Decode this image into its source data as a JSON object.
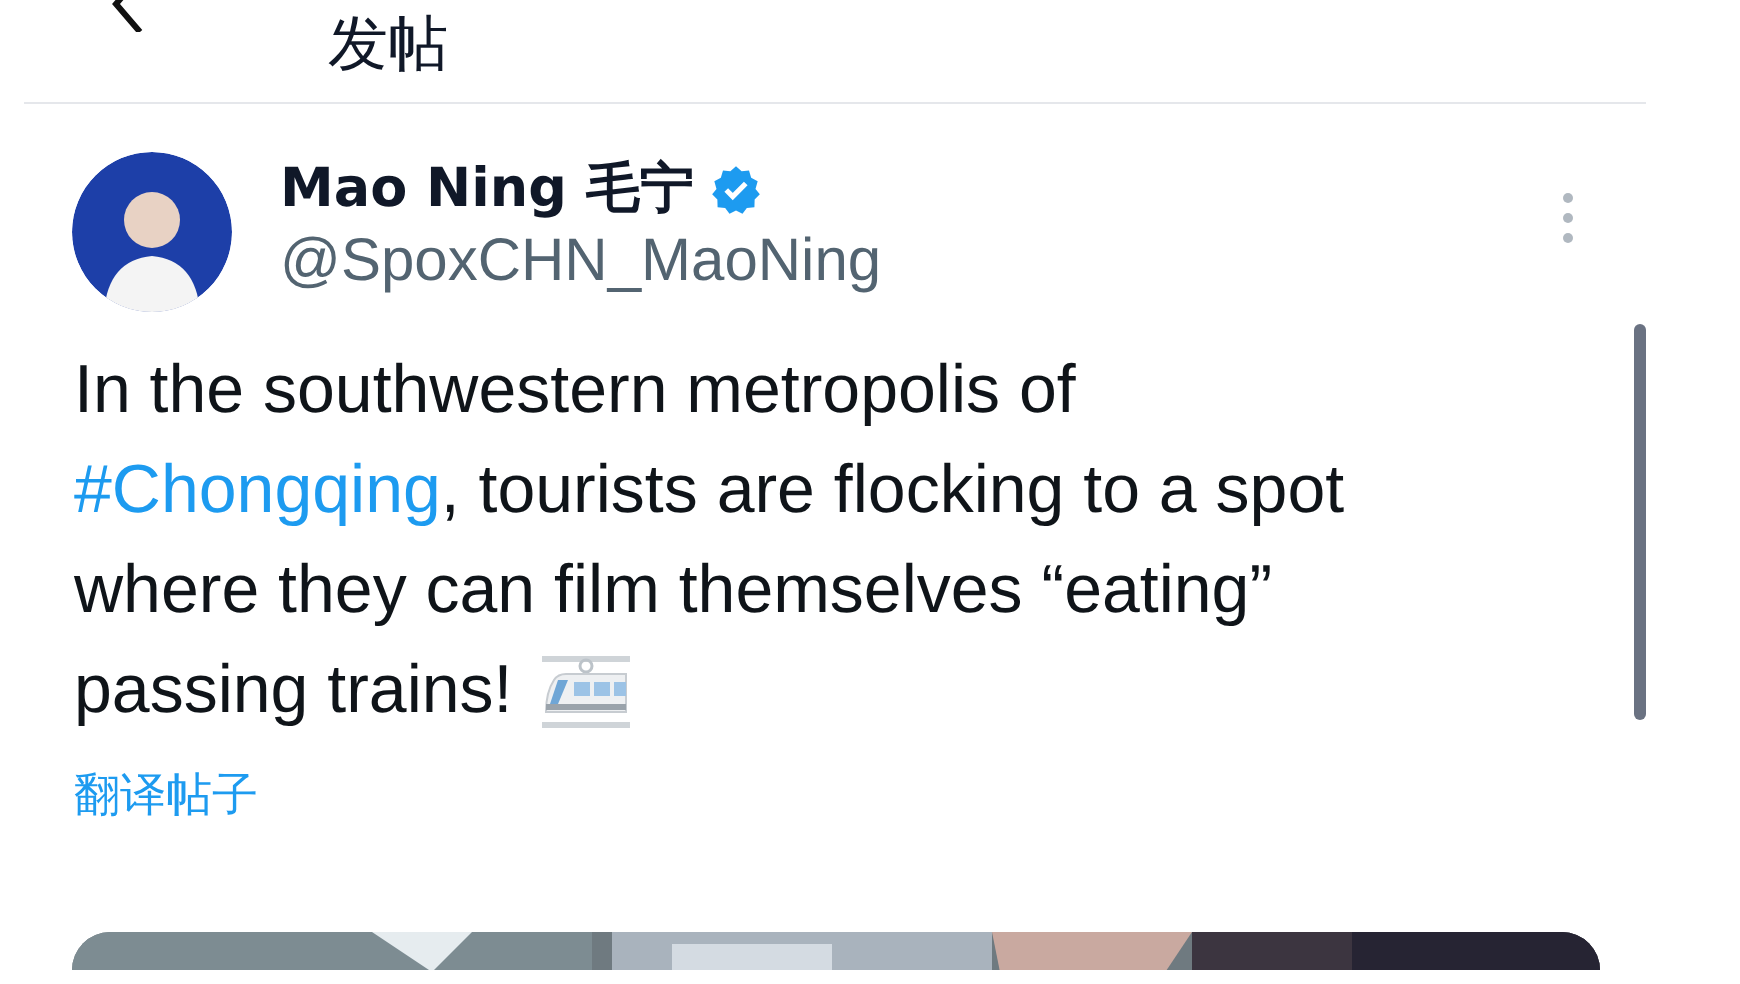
{
  "header": {
    "title": "发帖"
  },
  "post": {
    "author": {
      "name": "Mao Ning 毛宁",
      "verified": true,
      "handle": "@SpoxCHN_MaoNing"
    },
    "body": [
      {
        "kind": "text",
        "text": "In the southwestern metropolis of "
      },
      {
        "kind": "hashtag",
        "text": "#Chongqing"
      },
      {
        "kind": "text",
        "text": ", tourists are flocking to a spot where they can film themselves “eating” passing trains!"
      }
    ],
    "translate_link": "翻译帖子"
  }
}
